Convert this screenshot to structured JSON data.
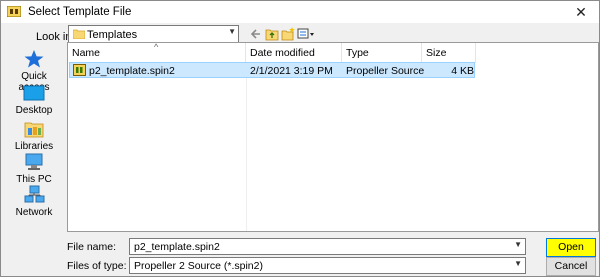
{
  "window": {
    "title": "Select Template File",
    "close_glyph": "✕"
  },
  "lookin": {
    "label": "Look in:",
    "value": "Templates"
  },
  "places": [
    {
      "label": "Quick access",
      "icon": "star-icon"
    },
    {
      "label": "Desktop",
      "icon": "desktop-icon"
    },
    {
      "label": "Libraries",
      "icon": "libraries-icon"
    },
    {
      "label": "This PC",
      "icon": "computer-icon"
    },
    {
      "label": "Network",
      "icon": "network-icon"
    }
  ],
  "columns": {
    "name": "Name",
    "date": "Date modified",
    "type": "Type",
    "size": "Size",
    "sort_glyph": "^"
  },
  "files": [
    {
      "name": "p2_template.spin2",
      "date": "2/1/2021 3:19 PM",
      "type": "Propeller Source C...",
      "size": "4 KB"
    }
  ],
  "form": {
    "filename_label": "File name:",
    "filename_value": "p2_template.spin2",
    "filetype_label": "Files of type:",
    "filetype_value": "Propeller 2 Source (*.spin2)",
    "open_label": "Open",
    "cancel_label": "Cancel"
  },
  "colors": {
    "selection": "#cce8ff",
    "open_highlight": "#ffff00",
    "star": "#1e6fd9"
  }
}
